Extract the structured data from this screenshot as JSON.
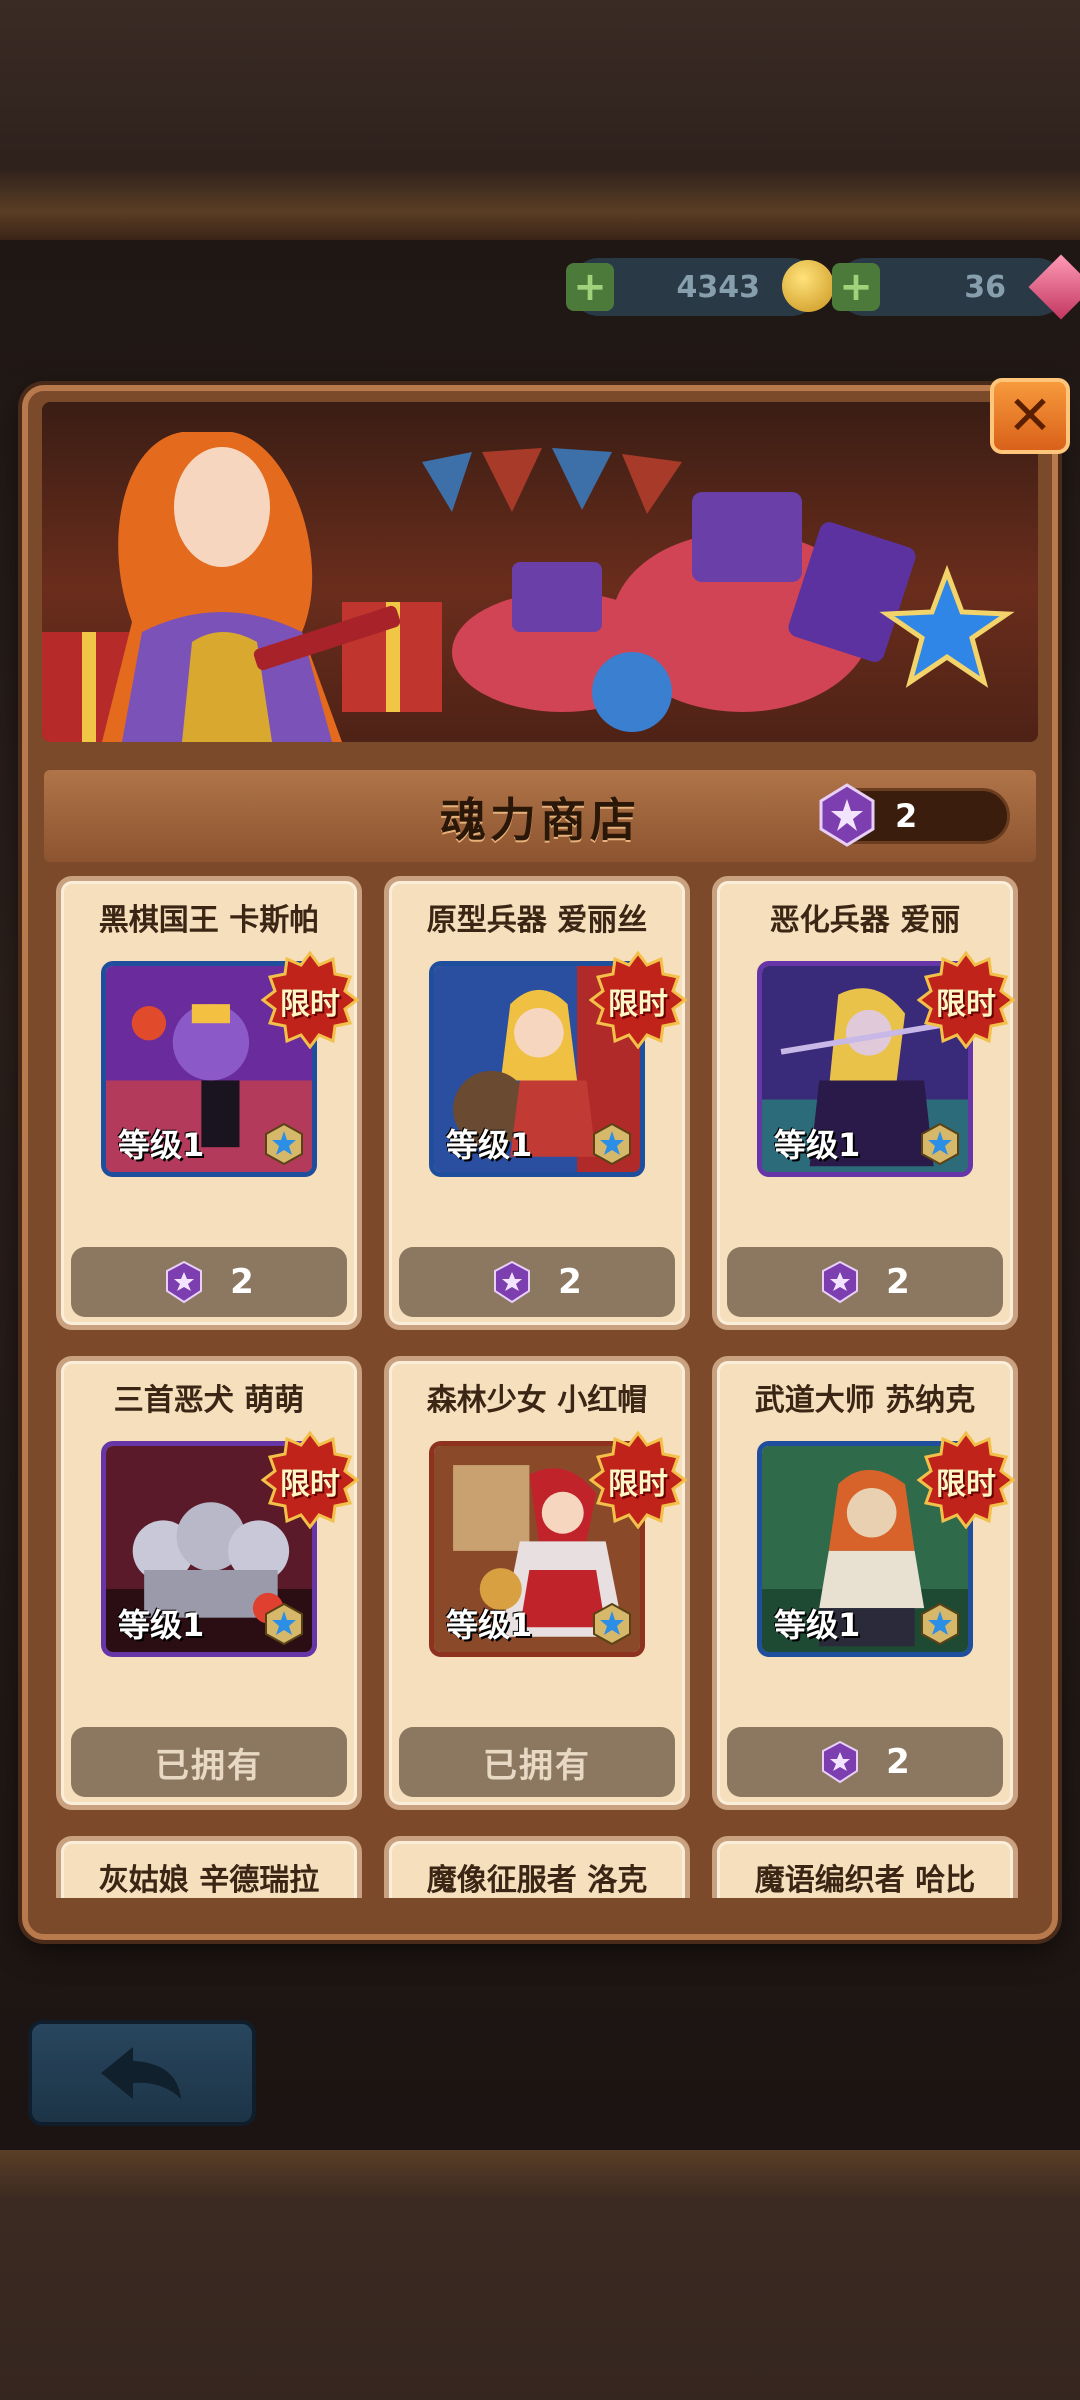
{
  "resources": {
    "coins": "4343",
    "gems": "36"
  },
  "shop": {
    "title": "魂力商店",
    "currency_count": "2",
    "limited_badge": "限时",
    "level_label": "等级1",
    "owned_label": "已拥有"
  },
  "cards": [
    {
      "name": "黑棋国王 卡斯帕",
      "price": "2",
      "owned": false
    },
    {
      "name": "原型兵器 爱丽丝",
      "price": "2",
      "owned": false
    },
    {
      "name": "恶化兵器 爱丽",
      "price": "2",
      "owned": false
    },
    {
      "name": "三首恶犬 萌萌",
      "price": null,
      "owned": true
    },
    {
      "name": "森林少女 小红帽",
      "price": null,
      "owned": true
    },
    {
      "name": "武道大师 苏纳克",
      "price": "2",
      "owned": false
    },
    {
      "name": "灰姑娘 辛德瑞拉"
    },
    {
      "name": "魔像征服者 洛克"
    },
    {
      "name": "魔语编织者 哈比"
    }
  ],
  "colors": {
    "card_bg": "#f6dfbd",
    "price_button": "#8c7860",
    "limited_badge": "#c0231a",
    "soul_gem": "#7d3fb0"
  },
  "icons": {
    "coin": "coin-icon",
    "gem": "gem-icon",
    "soul_currency": "soul-gem-icon",
    "close": "close-icon",
    "back": "back-arrow-icon",
    "rarity": "star-badge-icon"
  }
}
